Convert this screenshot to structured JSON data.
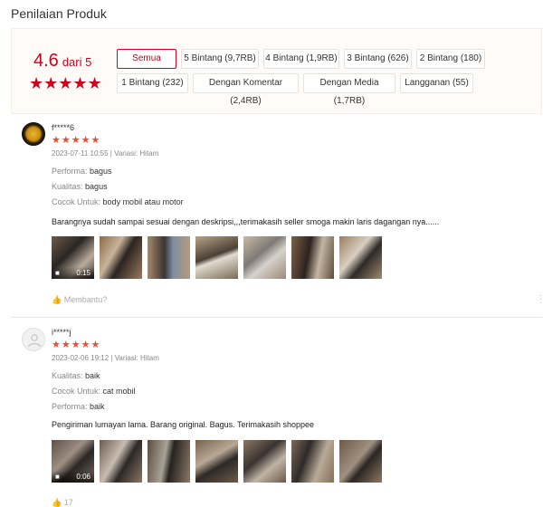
{
  "page_title": "Penilaian Produk",
  "summary": {
    "score": "4.6",
    "out_of": "dari 5",
    "stars": "★★★★★",
    "filters": [
      {
        "label": "Semua",
        "active": true
      },
      {
        "label": "5 Bintang (9,7RB)"
      },
      {
        "label": "4 Bintang (1,9RB)"
      },
      {
        "label": "3 Bintang (626)"
      },
      {
        "label": "2 Bintang (180)"
      },
      {
        "label": "1 Bintang (232)"
      },
      {
        "label": "Dengan Komentar (2,4RB)"
      },
      {
        "label": "Dengan Media (1,7RB)"
      },
      {
        "label": "Langganan (55)"
      }
    ]
  },
  "reviews": [
    {
      "username": "f*****6",
      "stars": "★★★★★",
      "meta": "2023-07-11 10:55 | Variasi: Hitam",
      "attrs": [
        {
          "key": "Performa:",
          "value": "bagus"
        },
        {
          "key": "Kualitas:",
          "value": "bagus"
        },
        {
          "key": "Cocok Untuk:",
          "value": "body mobil atau motor"
        }
      ],
      "comment": "Barangnya sudah sampai sesuai dengan deskripsi,,,terimakasih seller smoga makin laris dagangan nya......",
      "video_duration": "0:15",
      "helpful": "Membantu?"
    },
    {
      "username": "i*****j",
      "stars": "★★★★★",
      "meta": "2023-02-06 19:12 | Variasi: Hitam",
      "attrs": [
        {
          "key": "Kualitas:",
          "value": "baik"
        },
        {
          "key": "Cocok Untuk:",
          "value": "cat mobil"
        },
        {
          "key": "Performa:",
          "value": "baik"
        }
      ],
      "comment": "Pengiriman lumayan lama. Barang original. Bagus. Terimakasih shoppee",
      "video_duration": "0:06",
      "helpful": "17"
    }
  ]
}
